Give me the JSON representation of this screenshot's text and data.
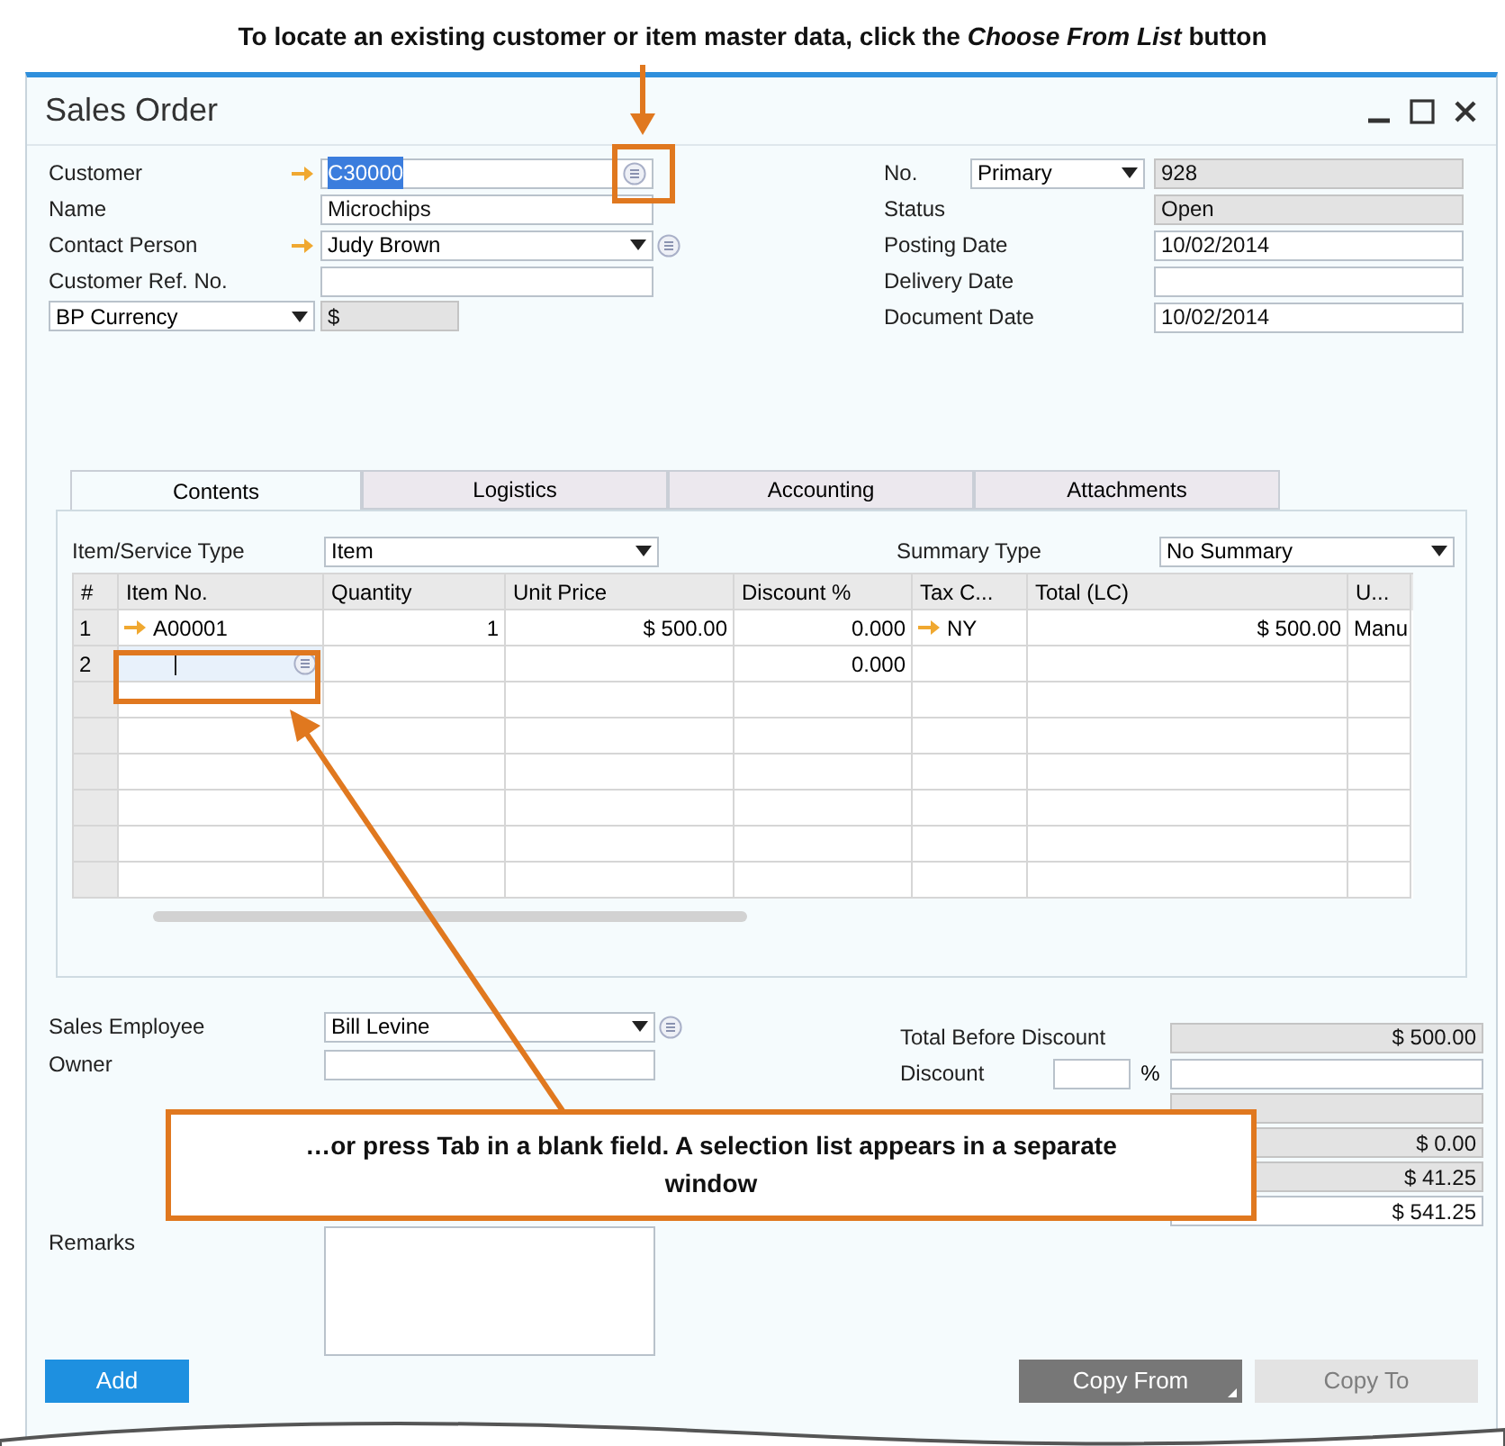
{
  "instruction": "To locate an existing customer or item master data, click the *Choose From List* button",
  "window": {
    "title": "Sales Order"
  },
  "customer": {
    "label": "Customer",
    "value": "C30000",
    "text_selected": true
  },
  "name": {
    "label": "Name",
    "value": "Microchips"
  },
  "contact_person": {
    "label": "Contact Person",
    "value": "Judy Brown"
  },
  "customer_ref": {
    "label": "Customer Ref. No."
  },
  "currency": {
    "type": "BP Currency",
    "value": "$"
  },
  "number": {
    "label": "No.",
    "series": "Primary",
    "value": "928"
  },
  "status": {
    "label": "Status",
    "value": "Open"
  },
  "posting_date": {
    "label": "Posting Date",
    "value": "10/02/2014"
  },
  "delivery_date": {
    "label": "Delivery Date"
  },
  "document_date": {
    "label": "Document Date",
    "value": "10/02/2014"
  },
  "tabs": [
    {
      "label": "Contents",
      "selected": true
    },
    {
      "label": "Logistics",
      "selected": false
    },
    {
      "label": "Accounting",
      "selected": false
    },
    {
      "label": "Attachments",
      "selected": false
    }
  ],
  "item_type": {
    "label": "Item/Service Type",
    "value": "Item"
  },
  "summary_type": {
    "label": "Summary Type",
    "value": "No Summary"
  },
  "table": {
    "columns": [
      "#",
      "Item No.",
      "Quantity",
      "Unit Price",
      "Discount %",
      "Tax C...",
      "Total (LC)",
      "U..."
    ],
    "rows": [
      {
        "number": "1",
        "item_no": "A00001",
        "item_linked": true,
        "quantity": "1",
        "unit_price": "$ 500.00",
        "discount": "0.000",
        "tax_code": "NY",
        "tax_linked": true,
        "total": "$ 500.00",
        "column_8": "Manu",
        "selected": false
      },
      {
        "number": "2",
        "item_linked": false,
        "discount": "0.000",
        "tax_linked": false,
        "selected": true
      }
    ]
  },
  "sales_employee": {
    "label": "Sales Employee",
    "value": "Bill Levine"
  },
  "owner": {
    "label": "Owner"
  },
  "remarks": {
    "label": "Remarks"
  },
  "total_before_discount": {
    "label": "Total Before Discount",
    "value": "$ 500.00"
  },
  "discount": {
    "label": "Discount",
    "unit": "%"
  },
  "covered_totals": [
    {
      "value": "$ 0.00"
    },
    {
      "value": "$ 41.25"
    },
    {
      "value": "$ 541.25"
    }
  ],
  "buttons": [
    {
      "label": "Add",
      "kind": "primary",
      "disabled": false
    },
    {
      "label": "Copy From",
      "kind": "menu",
      "disabled": false
    },
    {
      "label": "Copy To",
      "kind": "menu",
      "disabled": true
    }
  ],
  "callout": "…or press Tab in a blank field. A selection list appears in a separate window"
}
